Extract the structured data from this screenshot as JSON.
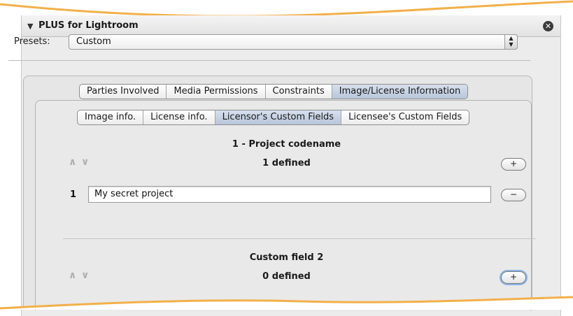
{
  "panel": {
    "title": "PLUS for Lightroom",
    "disclosure_icon": "disclosure-triangle-icon",
    "close_icon": "close-circle-icon"
  },
  "presets": {
    "label": "Presets:",
    "value": "Custom"
  },
  "main_tabs": [
    {
      "label": "Parties Involved",
      "active": false
    },
    {
      "label": "Media Permissions",
      "active": false
    },
    {
      "label": "Constraints",
      "active": false
    },
    {
      "label": "Image/License Information",
      "active": true
    }
  ],
  "sub_tabs": [
    {
      "label": "Image info.",
      "active": false
    },
    {
      "label": "License info.",
      "active": false
    },
    {
      "label": "Licensor's Custom Fields",
      "active": true
    },
    {
      "label": "Licensee's Custom Fields",
      "active": false
    }
  ],
  "fields": [
    {
      "title": "1 - Project codename",
      "count_text": "1 defined",
      "add_label": "+",
      "entries": [
        {
          "index": "1",
          "value": "My secret project",
          "remove_label": "−"
        }
      ]
    },
    {
      "title": "Custom field 2",
      "count_text": "0 defined",
      "add_label": "+",
      "entries": []
    }
  ],
  "arrows": {
    "up": "∧",
    "down": "∨"
  },
  "colors": {
    "edge_accent": "#f5b648",
    "active_tab": "#c6d2e4",
    "panel_bg": "#ececec"
  }
}
